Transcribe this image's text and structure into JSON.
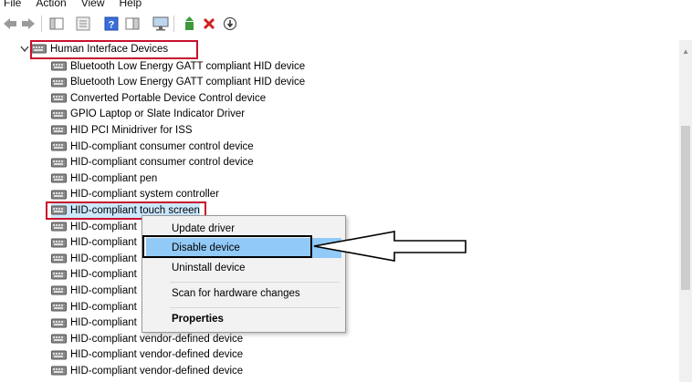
{
  "menu": {
    "file": "File",
    "action": "Action",
    "view": "View",
    "help": "Help"
  },
  "toolbar": {
    "back_icon": "back-arrow-icon",
    "forward_icon": "forward-arrow-icon",
    "show_hide_icon": "console-tree-icon",
    "properties_icon": "properties-icon",
    "help_icon": "help-icon",
    "action_pane_icon": "action-pane-icon",
    "monitor_icon": "scan-hardware-icon",
    "update_icon": "update-driver-icon",
    "uninstall_icon": "uninstall-icon",
    "disable_icon": "disable-device-icon"
  },
  "tree": {
    "category": "Human Interface Devices",
    "devices": [
      "Bluetooth Low Energy GATT compliant HID device",
      "Bluetooth Low Energy GATT compliant HID device",
      "Converted Portable Device Control device",
      "GPIO Laptop or Slate Indicator Driver",
      "HID PCI Minidriver for ISS",
      "HID-compliant consumer control device",
      "HID-compliant consumer control device",
      "HID-compliant pen",
      "HID-compliant system controller",
      "HID-compliant touch screen",
      "HID-compliant",
      "HID-compliant",
      "HID-compliant",
      "HID-compliant",
      "HID-compliant",
      "HID-compliant",
      "HID-compliant",
      "HID-compliant vendor-defined device",
      "HID-compliant vendor-defined device",
      "HID-compliant vendor-defined device"
    ]
  },
  "context_menu": {
    "update": "Update driver",
    "disable": "Disable device",
    "uninstall": "Uninstall device",
    "scan": "Scan for hardware changes",
    "properties": "Properties"
  },
  "colors": {
    "highlight_red": "#c8102e",
    "selection_blue": "#cce8ff",
    "menu_hover_blue": "#91c9f7"
  }
}
